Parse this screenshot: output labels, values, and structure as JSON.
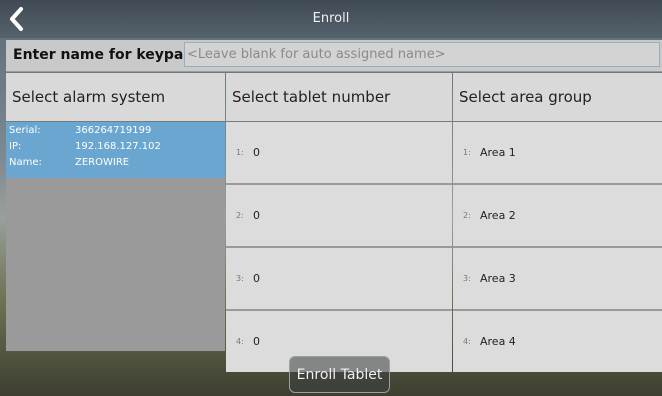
{
  "header": {
    "title": "Enroll",
    "back_icon": "chevron-left-icon"
  },
  "name_row": {
    "label": "Enter name for keypad:",
    "placeholder": "<Leave blank for auto assigned name>",
    "value": ""
  },
  "columns": {
    "alarm": {
      "heading": "Select alarm system"
    },
    "tablet": {
      "heading": "Select tablet number"
    },
    "area": {
      "heading": "Select area group"
    }
  },
  "alarm_systems": [
    {
      "serial_label": "Serial:",
      "serial": "366264719199",
      "ip_label": "IP:",
      "ip": "192.168.127.102",
      "name_label": "Name:",
      "name": "ZEROWIRE",
      "selected": true
    }
  ],
  "tablets": [
    {
      "index": "1:",
      "value": "0"
    },
    {
      "index": "2:",
      "value": "0"
    },
    {
      "index": "3:",
      "value": "0"
    },
    {
      "index": "4:",
      "value": "0"
    }
  ],
  "areas": [
    {
      "index": "1:",
      "label": "Area 1"
    },
    {
      "index": "2:",
      "label": "Area 2"
    },
    {
      "index": "3:",
      "label": "Area 3"
    },
    {
      "index": "4:",
      "label": "Area 4"
    }
  ],
  "footer": {
    "enroll_label": "Enroll Tablet"
  },
  "colors": {
    "selection": "#6aa6d0",
    "cell": "#dcdcdc",
    "divider": "#9a9a9a"
  }
}
